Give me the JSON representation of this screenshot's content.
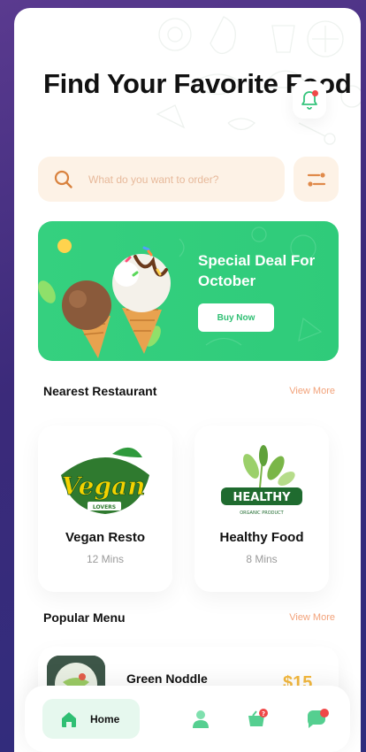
{
  "header": {
    "title": "Find Your Favorite Food"
  },
  "search": {
    "placeholder": "What do you want to order?"
  },
  "promo": {
    "title": "Special Deal For October",
    "button_label": "Buy Now"
  },
  "nearest": {
    "heading": "Nearest Restaurant",
    "view_more": "View More",
    "restaurants": [
      {
        "name": "Vegan Resto",
        "time": "12 Mins",
        "logo_text": "Vegan",
        "logo_sub": "LOVERS"
      },
      {
        "name": "Healthy Food",
        "time": "8 Mins",
        "logo_text": "HEALTHY",
        "logo_sub": "ORGANIC PRODUCT"
      }
    ]
  },
  "popular": {
    "heading": "Popular Menu",
    "view_more": "View More",
    "items": [
      {
        "name": "Green Noddle",
        "price": "$15"
      }
    ]
  },
  "nav": {
    "home_label": "Home"
  },
  "colors": {
    "accent_green": "#35d07f",
    "search_bg": "#fdf2e6",
    "link_orange": "#f2a27a",
    "price_yellow": "#f3b83e",
    "badge_red": "#f04848"
  }
}
